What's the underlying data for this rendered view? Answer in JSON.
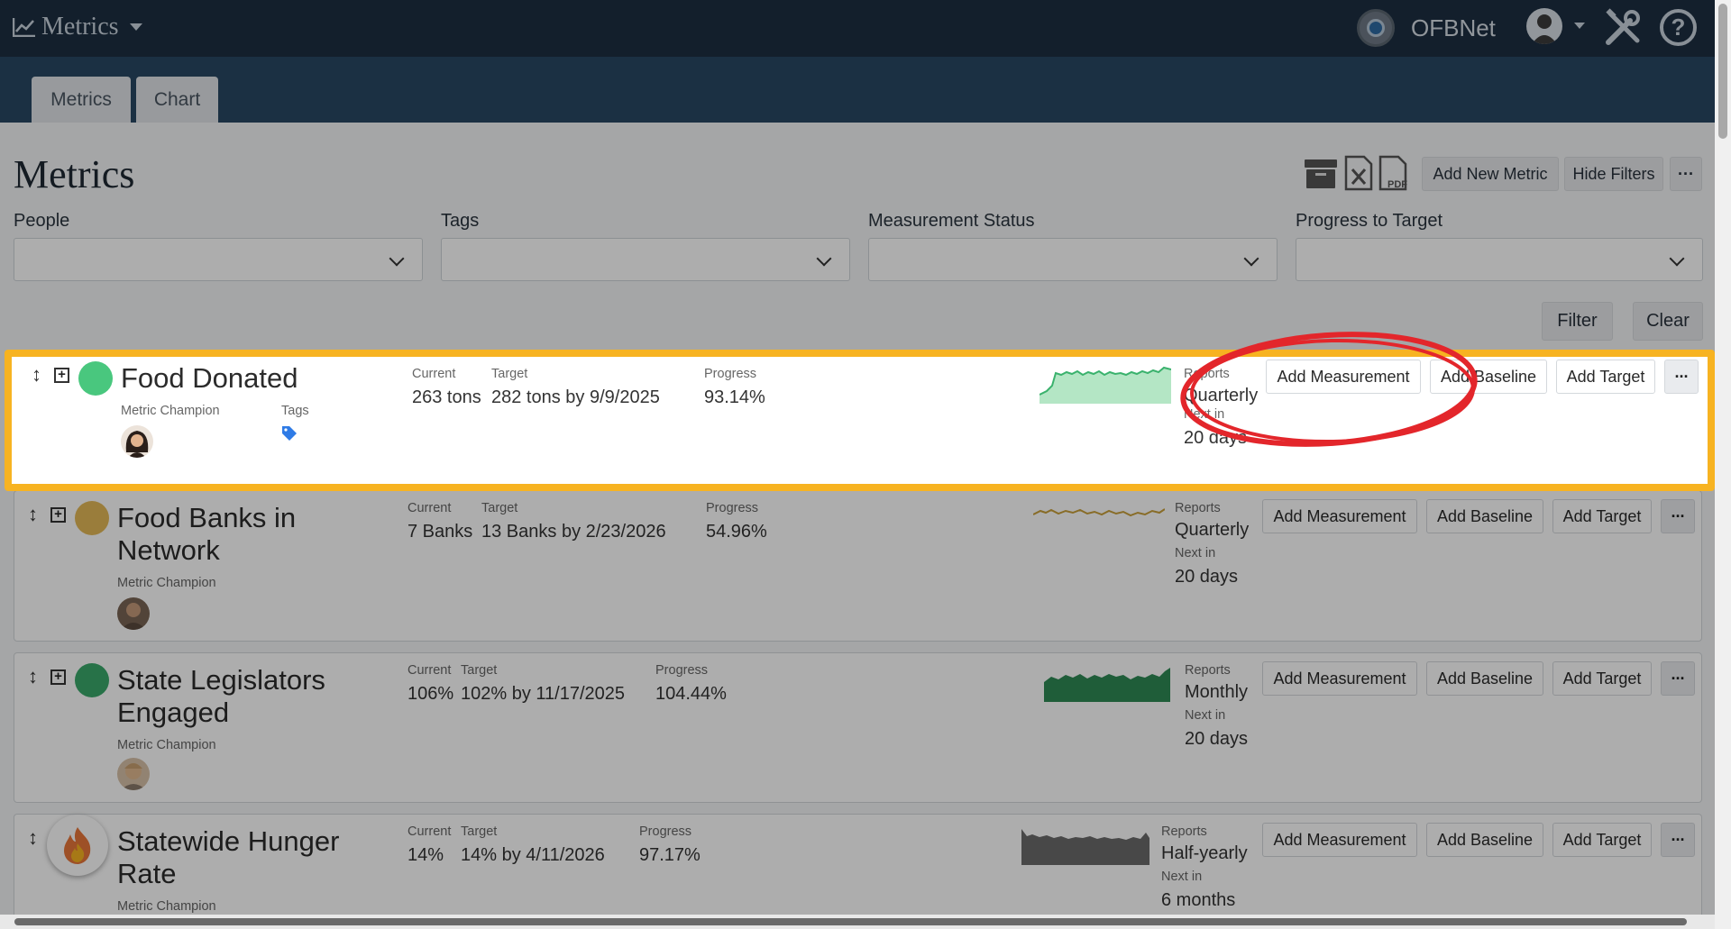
{
  "header": {
    "app_name": "Metrics",
    "org_name": "OFBNet",
    "help_glyph": "?"
  },
  "tabs": [
    {
      "label": "Metrics"
    },
    {
      "label": "Chart"
    }
  ],
  "page": {
    "title": "Metrics",
    "add_new_metric": "Add New Metric",
    "hide_filters": "Hide Filters",
    "more": "···"
  },
  "filters": {
    "people": "People",
    "tags": "Tags",
    "measurement_status": "Measurement Status",
    "progress_to_target": "Progress to Target",
    "filter_btn": "Filter",
    "clear_btn": "Clear"
  },
  "labels": {
    "current": "Current",
    "target": "Target",
    "progress": "Progress",
    "metric_champion": "Metric Champion",
    "tags": "Tags",
    "reports": "Reports",
    "next_in": "Next in",
    "add_measurement": "Add Measurement",
    "add_baseline": "Add Baseline",
    "add_target": "Add Target",
    "more": "···"
  },
  "metrics": [
    {
      "title": "Food Donated",
      "current": "263 tons",
      "target": "282 tons by 9/9/2025",
      "progress": "93.14%",
      "frequency": "Quarterly",
      "next": "20 days",
      "status_color": "#49c77e"
    },
    {
      "title_line1": "Food Banks in",
      "title_line2": "Network",
      "current": "7 Banks",
      "target": "13 Banks by 2/23/2026",
      "progress": "54.96%",
      "frequency": "Quarterly",
      "next": "20 days",
      "status_color": "#e4b957"
    },
    {
      "title_line1": "State Legislators",
      "title_line2": "Engaged",
      "current": "106%",
      "target": "102% by 11/17/2025",
      "progress": "104.44%",
      "frequency": "Monthly",
      "next": "20 days",
      "status_color": "#3aa86a"
    },
    {
      "title_line1": "Statewide Hunger",
      "title_line2": "Rate",
      "current": "14%",
      "target": "14% by 4/11/2026",
      "progress": "97.17%",
      "frequency": "Half-yearly",
      "next": "6 months",
      "status_color": "#e8773a"
    }
  ],
  "icons": [
    "line-chart-icon",
    "caret-down-icon",
    "org-logo-icon",
    "user-avatar-icon",
    "tools-icon",
    "help-icon",
    "archive-icon",
    "excel-icon",
    "pdf-icon",
    "chevron-down-icon",
    "sort-handle-icon",
    "expand-icon",
    "tag-icon",
    "flame-icon"
  ]
}
